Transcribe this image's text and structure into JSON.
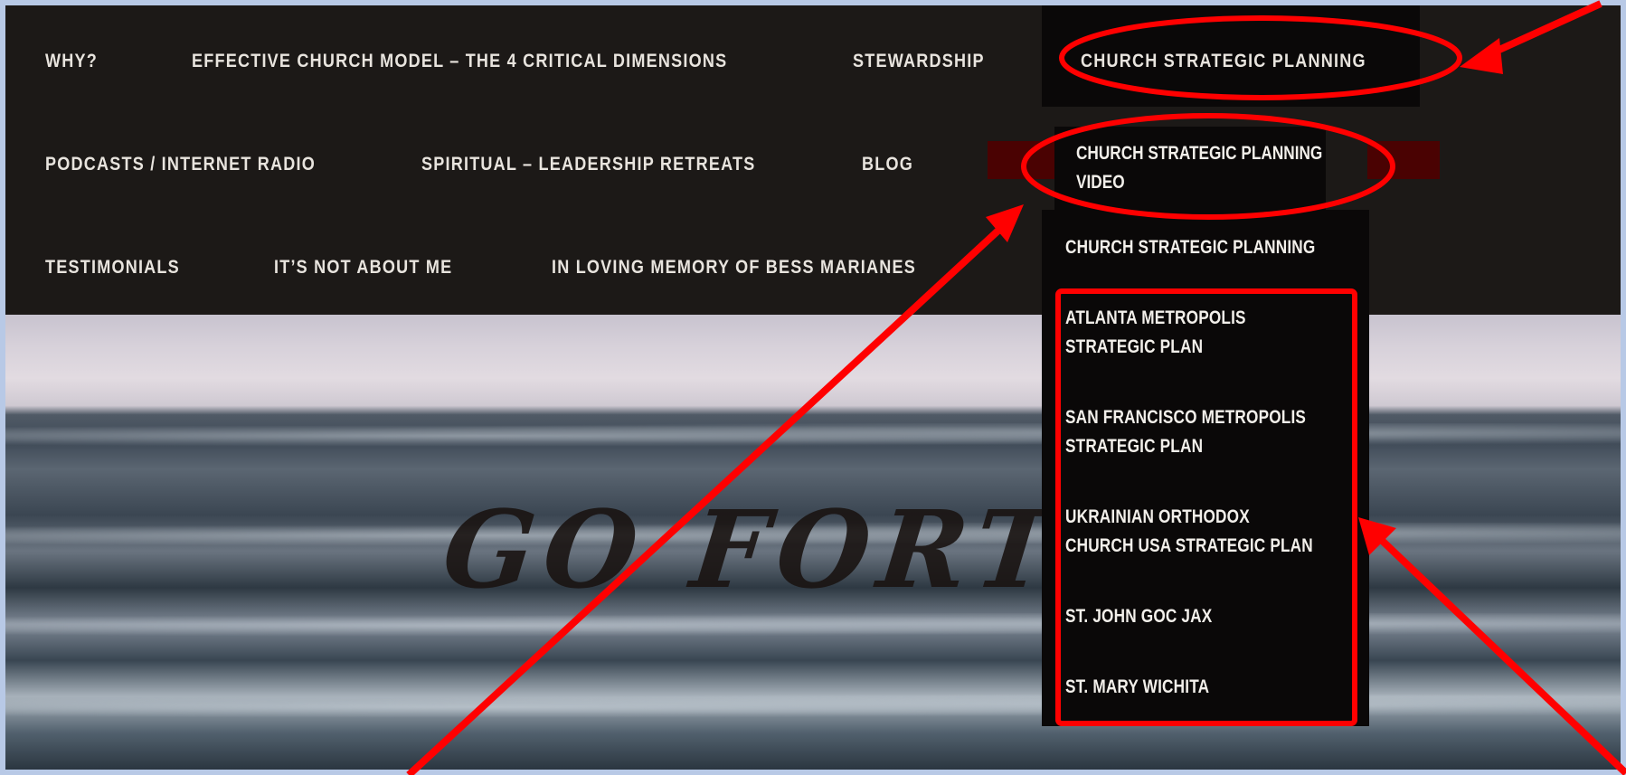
{
  "nav": {
    "row1": [
      "WHY?",
      "EFFECTIVE CHURCH MODEL – THE 4 CRITICAL DIMENSIONS",
      "STEWARDSHIP",
      "CHURCH STRATEGIC PLANNING"
    ],
    "row2": [
      "PODCASTS / INTERNET RADIO",
      "SPIRITUAL – LEADERSHIP RETREATS",
      "BLOG"
    ],
    "row3": [
      "TESTIMONIALS",
      "IT’S NOT ABOUT ME",
      "IN LOVING MEMORY OF BESS MARIANES"
    ]
  },
  "submenu": {
    "video_line1": "CHURCH STRATEGIC PLANNING",
    "video_line2": "VIDEO"
  },
  "dropdown": {
    "items": [
      {
        "line1": "CHURCH STRATEGIC PLANNING",
        "line2": ""
      },
      {
        "line1": "ATLANTA METROPOLIS",
        "line2": "STRATEGIC PLAN"
      },
      {
        "line1": "SAN FRANCISCO METROPOLIS",
        "line2": "STRATEGIC PLAN"
      },
      {
        "line1": "UKRAINIAN ORTHODOX",
        "line2": "CHURCH USA STRATEGIC PLAN"
      },
      {
        "line1": "ST. JOHN GOC JAX",
        "line2": ""
      },
      {
        "line1": "ST. MARY WICHITA",
        "line2": ""
      }
    ]
  },
  "hero": {
    "headline": "GO FORT"
  },
  "colors": {
    "nav_bg": "#1c1917",
    "nav_text": "#e8e4de",
    "dropdown_bg": "#0a0808",
    "annotation": "#ff0000",
    "frame": "#b8c9e6"
  }
}
